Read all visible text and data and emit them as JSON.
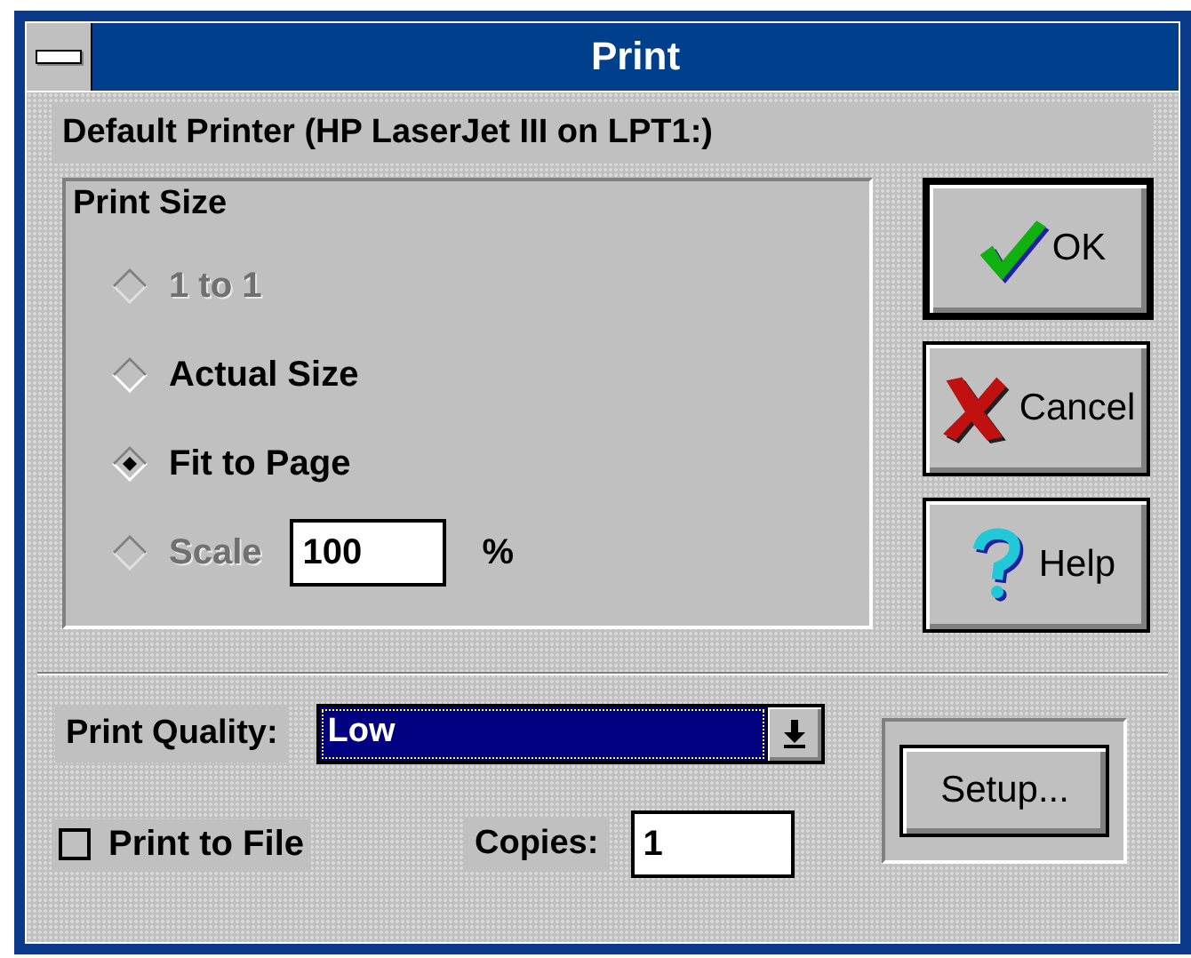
{
  "window": {
    "title": "Print"
  },
  "printer": "Default Printer (HP LaserJet III on LPT1:)",
  "print_size": {
    "title": "Print Size",
    "options": [
      {
        "label": "1 to 1",
        "selected": false,
        "disabled": true
      },
      {
        "label": "Actual Size",
        "selected": false,
        "disabled": false
      },
      {
        "label": "Fit to Page",
        "selected": true,
        "disabled": false
      },
      {
        "label": "Scale",
        "selected": false,
        "disabled": true
      }
    ],
    "scale_value": "100",
    "scale_unit": "%"
  },
  "buttons": [
    {
      "kind": "ok",
      "label": "OK",
      "default": true
    },
    {
      "kind": "cancel",
      "label": "Cancel",
      "default": false
    },
    {
      "kind": "help",
      "label": "Help",
      "default": false
    }
  ],
  "quality": {
    "label": "Print Quality:",
    "value": "Low"
  },
  "setup_button": "Setup...",
  "print_to_file": {
    "label": "Print to File",
    "checked": false
  },
  "copies": {
    "label": "Copies:",
    "value": "1"
  }
}
